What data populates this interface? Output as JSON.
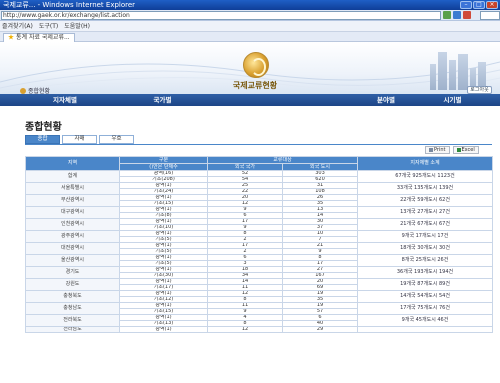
{
  "window": {
    "title": "국제교류... - Windows Internet Explorer",
    "address": "http://www.gaek.or.kr/exchange/list.action"
  },
  "menu": [
    "즐겨찾기(A)",
    "도구(T)",
    "도움말(H)"
  ],
  "tab": {
    "label": "통계 자료 국제교류..."
  },
  "site": {
    "logo_label": "종합현황",
    "title": "국제교류현황",
    "login_label": "로그아웃",
    "nav": [
      "지자체별",
      "국가별",
      "분야별",
      "시기별"
    ]
  },
  "page": {
    "title": "종합현황",
    "subtabs": [
      "종합",
      "자매",
      "우호"
    ],
    "print_label": "Print",
    "excel_label": "Excel"
  },
  "table": {
    "headers": {
      "region": "지역",
      "type": "구분",
      "type_sub": "()안은 단체수",
      "partner": "교류대상",
      "foreign": "외국 국가",
      "domestic": "외국 도시",
      "summary": "지자체별 소계"
    },
    "groups": [
      {
        "region": "합계",
        "total": "67개국 925개도시 1123건",
        "rows": [
          {
            "type": "광역(16)",
            "a": "52",
            "b": "303"
          },
          {
            "type": "기초(208)",
            "a": "54",
            "b": "620"
          }
        ]
      },
      {
        "region": "서울특별시",
        "total": "33개국 135개도시 139건",
        "rows": [
          {
            "type": "광역(1)",
            "a": "25",
            "b": "31"
          },
          {
            "type": "기초(24)",
            "a": "22",
            "b": "108"
          }
        ]
      },
      {
        "region": "부산광역시",
        "total": "22개국 59개도시 62건",
        "rows": [
          {
            "type": "광역(1)",
            "a": "20",
            "b": "26"
          },
          {
            "type": "기초(15)",
            "a": "12",
            "b": "35"
          }
        ]
      },
      {
        "region": "대구광역시",
        "total": "13개국 27개도시 27건",
        "rows": [
          {
            "type": "광역(1)",
            "a": "9",
            "b": "13"
          },
          {
            "type": "기초(8)",
            "a": "6",
            "b": "14"
          }
        ]
      },
      {
        "region": "인천광역시",
        "total": "21개국 67개도시 67건",
        "rows": [
          {
            "type": "광역(1)",
            "a": "17",
            "b": "30"
          },
          {
            "type": "기초(10)",
            "a": "9",
            "b": "37"
          }
        ]
      },
      {
        "region": "광주광역시",
        "total": "9개국 17개도시 17건",
        "rows": [
          {
            "type": "광역(1)",
            "a": "8",
            "b": "10"
          },
          {
            "type": "기초(5)",
            "a": "2",
            "b": "7"
          }
        ]
      },
      {
        "region": "대전광역시",
        "total": "18개국 30개도시 30건",
        "rows": [
          {
            "type": "광역(1)",
            "a": "17",
            "b": "21"
          },
          {
            "type": "기초(5)",
            "a": "2",
            "b": "9"
          }
        ]
      },
      {
        "region": "울산광역시",
        "total": "8개국 25개도시 26건",
        "rows": [
          {
            "type": "광역(1)",
            "a": "6",
            "b": "8"
          },
          {
            "type": "기초(5)",
            "a": "3",
            "b": "17"
          }
        ]
      },
      {
        "region": "경기도",
        "total": "36개국 193개도시 194건",
        "rows": [
          {
            "type": "광역(1)",
            "a": "18",
            "b": "27"
          },
          {
            "type": "기초(30)",
            "a": "34",
            "b": "167"
          }
        ]
      },
      {
        "region": "강원도",
        "total": "19개국 87개도시 89건",
        "rows": [
          {
            "type": "광역(1)",
            "a": "14",
            "b": "20"
          },
          {
            "type": "기초(17)",
            "a": "11",
            "b": "69"
          }
        ]
      },
      {
        "region": "충청북도",
        "total": "14개국 54개도시 54건",
        "rows": [
          {
            "type": "광역(1)",
            "a": "12",
            "b": "19"
          },
          {
            "type": "기초(12)",
            "a": "8",
            "b": "35"
          }
        ]
      },
      {
        "region": "충청남도",
        "total": "17개국 75개도시 76건",
        "rows": [
          {
            "type": "광역(1)",
            "a": "11",
            "b": "19"
          },
          {
            "type": "기초(15)",
            "a": "9",
            "b": "57"
          }
        ]
      },
      {
        "region": "전라북도",
        "total": "9개국 45개도시 46건",
        "rows": [
          {
            "type": "광역(1)",
            "a": "4",
            "b": "6"
          },
          {
            "type": "기초(13)",
            "a": "8",
            "b": "40"
          }
        ]
      },
      {
        "region": "전라남도",
        "total": "",
        "rows": [
          {
            "type": "광역(1)",
            "a": "12",
            "b": "29"
          }
        ]
      }
    ]
  }
}
